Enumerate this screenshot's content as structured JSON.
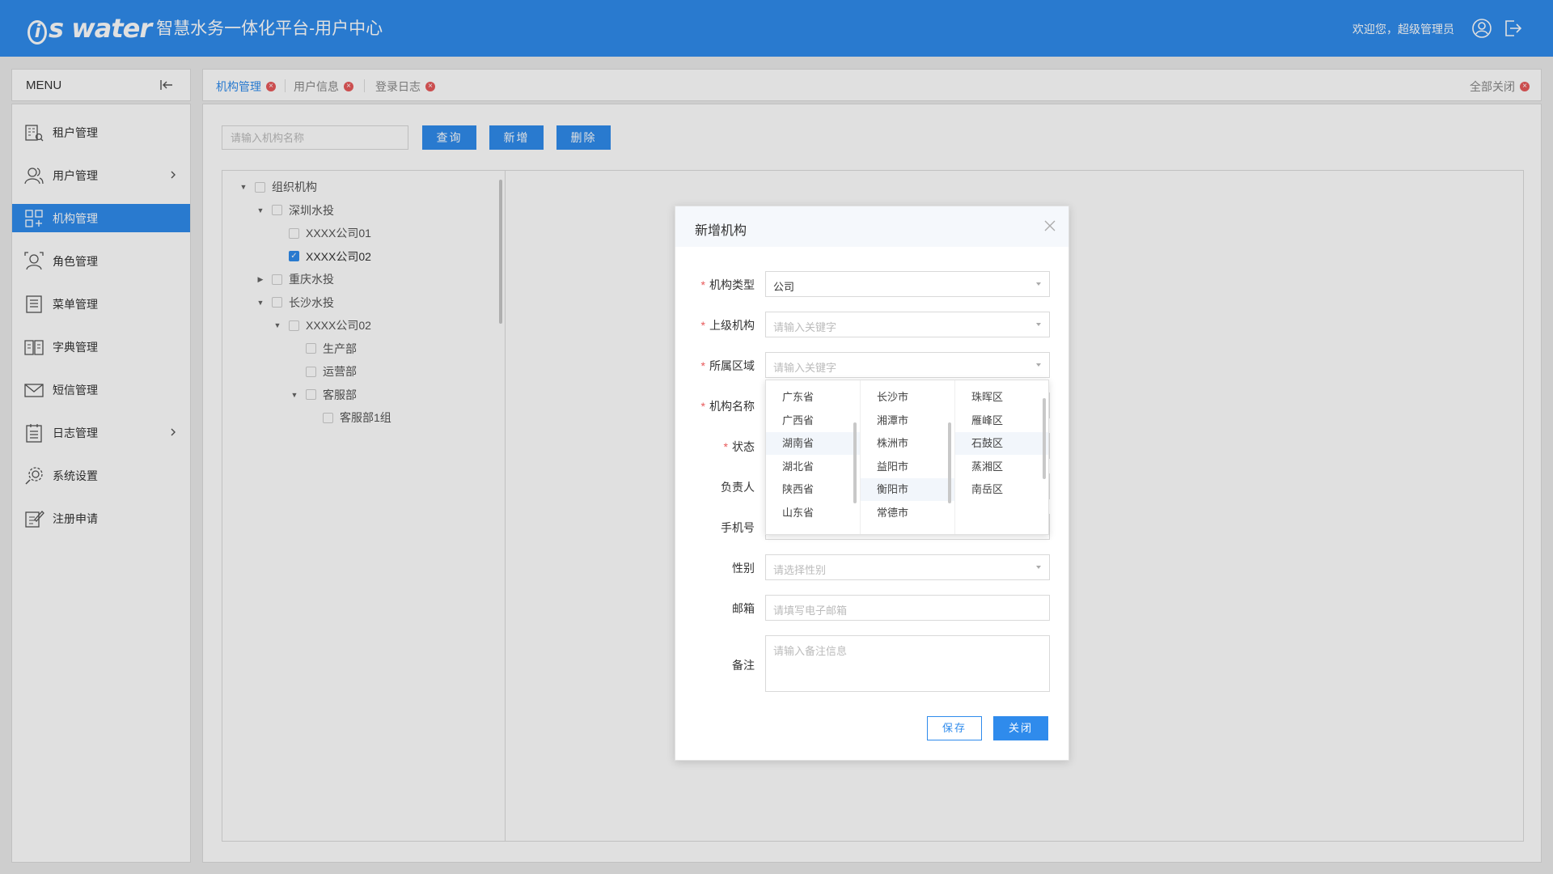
{
  "header": {
    "logo_text": "is water",
    "platform_title": "智慧水务一体化平台-用户中心",
    "welcome": "欢迎您，超级管理员"
  },
  "menu": {
    "title": "MENU",
    "items": [
      {
        "label": "租户管理",
        "icon": "tenant-icon",
        "has_arrow": false,
        "active": false
      },
      {
        "label": "用户管理",
        "icon": "users-icon",
        "has_arrow": true,
        "active": false
      },
      {
        "label": "机构管理",
        "icon": "organization-icon",
        "has_arrow": false,
        "active": true
      },
      {
        "label": "角色管理",
        "icon": "role-icon",
        "has_arrow": false,
        "active": false
      },
      {
        "label": "菜单管理",
        "icon": "menu-list-icon",
        "has_arrow": false,
        "active": false
      },
      {
        "label": "字典管理",
        "icon": "dictionary-icon",
        "has_arrow": false,
        "active": false
      },
      {
        "label": "短信管理",
        "icon": "sms-icon",
        "has_arrow": false,
        "active": false
      },
      {
        "label": "日志管理",
        "icon": "log-icon",
        "has_arrow": true,
        "active": false
      },
      {
        "label": "系统设置",
        "icon": "settings-icon",
        "has_arrow": false,
        "active": false
      },
      {
        "label": "注册申请",
        "icon": "register-icon",
        "has_arrow": false,
        "active": false
      }
    ]
  },
  "tabs": {
    "items": [
      {
        "label": "机构管理",
        "active": true
      },
      {
        "label": "用户信息",
        "active": false
      },
      {
        "label": "登录日志",
        "active": false
      }
    ],
    "close_all": "全部关闭"
  },
  "toolbar": {
    "search_placeholder": "请输入机构名称",
    "query": "查询",
    "add": "新增",
    "delete": "删除"
  },
  "tree": [
    {
      "label": "组织机构",
      "level": 0,
      "toggle": "open",
      "checked": false
    },
    {
      "label": "深圳水投",
      "level": 1,
      "toggle": "open",
      "checked": false
    },
    {
      "label": "XXXX公司01",
      "level": 2,
      "toggle": "none",
      "checked": false
    },
    {
      "label": "XXXX公司02",
      "level": 2,
      "toggle": "none",
      "checked": true
    },
    {
      "label": "重庆水投",
      "level": 1,
      "toggle": "closed",
      "checked": false
    },
    {
      "label": "长沙水投",
      "level": 1,
      "toggle": "open",
      "checked": false
    },
    {
      "label": "XXXX公司02",
      "level": 2,
      "toggle": "open",
      "checked": false
    },
    {
      "label": "生产部",
      "level": 3,
      "toggle": "none",
      "checked": false
    },
    {
      "label": "运营部",
      "level": 3,
      "toggle": "none",
      "checked": false
    },
    {
      "label": "客服部",
      "level": 3,
      "toggle": "open",
      "checked": false
    },
    {
      "label": "客服部1组",
      "level": 4,
      "toggle": "none",
      "checked": false
    }
  ],
  "modal": {
    "title": "新增机构",
    "fields": {
      "org_type": {
        "label": "机构类型",
        "required": true,
        "value": "公司"
      },
      "parent_org": {
        "label": "上级机构",
        "required": true,
        "placeholder": "请输入关键字"
      },
      "region": {
        "label": "所属区域",
        "required": true,
        "placeholder": "请输入关键字"
      },
      "org_name": {
        "label": "机构名称",
        "required": true
      },
      "status": {
        "label": "状态",
        "required": true
      },
      "manager": {
        "label": "负责人",
        "required": false
      },
      "phone": {
        "label": "手机号",
        "required": false
      },
      "gender": {
        "label": "性别",
        "required": false,
        "placeholder": "请选择性别"
      },
      "email": {
        "label": "邮箱",
        "required": false,
        "placeholder": "请填写电子邮箱"
      },
      "remark": {
        "label": "备注",
        "required": false,
        "placeholder": "请输入备注信息"
      }
    },
    "save": "保存",
    "close": "关闭"
  },
  "cascader": {
    "provinces": [
      "广东省",
      "广西省",
      "湖南省",
      "湖北省",
      "陕西省",
      "山东省"
    ],
    "cities": [
      "长沙市",
      "湘潭市",
      "株洲市",
      "益阳市",
      "衡阳市",
      "常德市"
    ],
    "districts": [
      "珠晖区",
      "雁峰区",
      "石鼓区",
      "蒸湘区",
      "南岳区"
    ],
    "highlighted": {
      "province": "湖南省",
      "city": "衡阳市",
      "district": "石鼓区"
    }
  },
  "colors": {
    "primary": "#2f8bec",
    "danger": "#e8595a"
  }
}
